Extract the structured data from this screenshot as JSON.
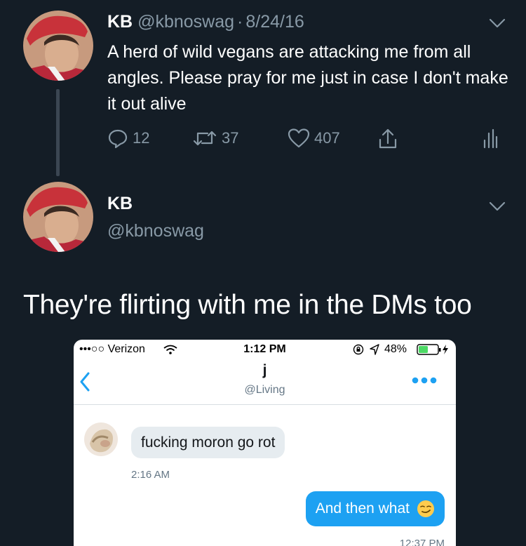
{
  "tweet1": {
    "display_name": "KB",
    "handle": "@kbnoswag",
    "separator": "·",
    "date": "8/24/16",
    "text": "A herd of wild vegans are attacking me from all angles. Please pray for me just in case I don't make it out alive",
    "replies": "12",
    "retweets": "37",
    "likes": "407"
  },
  "tweet2": {
    "display_name": "KB",
    "handle": "@kbnoswag",
    "text": "They're flirting with me in the DMs too"
  },
  "screenshot": {
    "status_bar": {
      "carrier": "•••○○ Verizon",
      "time": "1:12 PM",
      "battery": "48%"
    },
    "conversation": {
      "name": "j",
      "handle": "@Living"
    },
    "messages": [
      {
        "direction": "incoming",
        "text": "fucking moron go rot",
        "time": "2:16 AM"
      },
      {
        "direction": "outgoing",
        "text": "And then what",
        "time": "12:37 PM"
      }
    ]
  },
  "colors": {
    "background": "#141d26",
    "muted": "#8899a6",
    "twitter_blue": "#1da1f2"
  }
}
